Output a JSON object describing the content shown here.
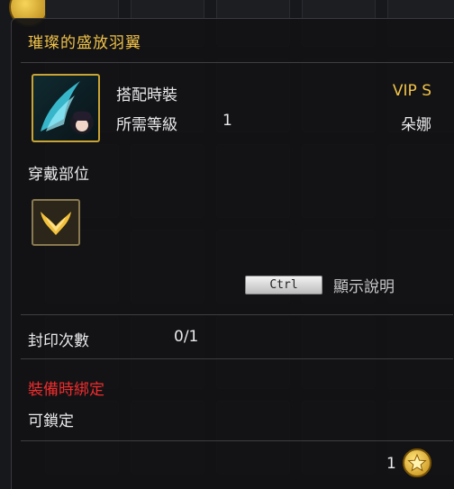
{
  "tooltip": {
    "title": "璀璨的盛放羽翼",
    "type_label": "搭配時裝",
    "vip": "VIP S",
    "required_level_label": "所需等級",
    "required_level": "1",
    "character": "朵娜",
    "wear_slot_label": "穿戴部位",
    "key_hint": "Ctrl",
    "key_hint_desc": "顯示說明",
    "seal_label": "封印次數",
    "seal_value": "0/1",
    "bind_text": "裝備時綁定",
    "lock_text": "可鎖定",
    "cost_count": "1"
  },
  "colors": {
    "title": "#f0c248",
    "bind": "#ef2c2c",
    "frame_gold": "#c9a334"
  },
  "icons": {
    "item": "wing-costume-icon",
    "slot": "wings-slot-icon",
    "currency": "gold-star-coin-icon"
  }
}
